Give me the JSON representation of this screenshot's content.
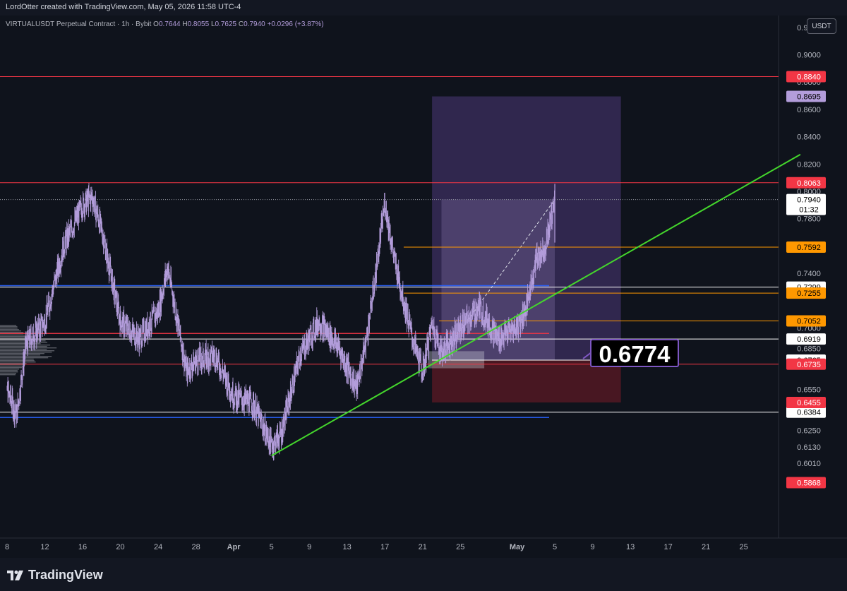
{
  "header": {
    "credit": "LordOtter created with TradingView.com, May 05, 2026 11:58 UTC-4"
  },
  "legend": {
    "symbol": "VIRTUALUSDT Perpetual Contract · 1h · Bybit",
    "open_label": "O",
    "open": "0.7644",
    "high_label": "H",
    "high": "0.8055",
    "low_label": "L",
    "low": "0.7625",
    "close_label": "C",
    "close": "0.7940",
    "change": "+0.0296 (+3.87%)"
  },
  "toolbar": {
    "currency": "USDT"
  },
  "callout": {
    "value": "0.6774"
  },
  "footer": {
    "brand": "TradingView"
  },
  "colors": {
    "background": "#0f131c",
    "candles": "#b39ddb",
    "red_level": "#f23645",
    "orange_level": "#ff9800",
    "blue_level": "#2962ff",
    "white_level": "#ffffff",
    "trendline": "#44d62c",
    "target_zone": "#7e57c2",
    "stop_zone": "#5c1a24"
  },
  "chart_data": {
    "type": "candlestick",
    "interval": "1h",
    "y_axis_ticks": [
      "0.9200",
      "0.9000",
      "0.8800",
      "0.8600",
      "0.8400",
      "0.8200",
      "0.8000",
      "0.7800",
      "0.7400",
      "0.7000",
      "0.6850",
      "0.6550",
      "0.6250",
      "0.6130",
      "0.6010"
    ],
    "x_axis_ticks": [
      "8",
      "12",
      "16",
      "20",
      "24",
      "28",
      "Apr",
      "5",
      "9",
      "13",
      "17",
      "21",
      "25",
      "May",
      "5",
      "9",
      "13",
      "17",
      "21",
      "25"
    ],
    "ylim": [
      0.585,
      0.925
    ],
    "price_path": [
      [
        "Mar 8",
        0.655
      ],
      [
        "Mar 9",
        0.636
      ],
      [
        "Mar 10",
        0.688
      ],
      [
        "Mar 12",
        0.705
      ],
      [
        "Mar 14",
        0.76
      ],
      [
        "Mar 16",
        0.79
      ],
      [
        "Mar 17",
        0.796
      ],
      [
        "Mar 18",
        0.772
      ],
      [
        "Mar 20",
        0.705
      ],
      [
        "Mar 22",
        0.692
      ],
      [
        "Mar 24",
        0.712
      ],
      [
        "Mar 25",
        0.745
      ],
      [
        "Mar 27",
        0.668
      ],
      [
        "Mar 28",
        0.676
      ],
      [
        "Mar 30",
        0.68
      ],
      [
        "Apr 1",
        0.65
      ],
      [
        "Apr 3",
        0.645
      ],
      [
        "Apr 5",
        0.614
      ],
      [
        "Apr 6",
        0.622
      ],
      [
        "Apr 8",
        0.68
      ],
      [
        "Apr 10",
        0.705
      ],
      [
        "Apr 12",
        0.687
      ],
      [
        "Apr 14",
        0.656
      ],
      [
        "Apr 15",
        0.69
      ],
      [
        "Apr 16",
        0.738
      ],
      [
        "Apr 17",
        0.792
      ],
      [
        "Apr 18",
        0.75
      ],
      [
        "Apr 20",
        0.69
      ],
      [
        "Apr 21",
        0.668
      ],
      [
        "Apr 22",
        0.703
      ],
      [
        "Apr 23",
        0.682
      ],
      [
        "Apr 25",
        0.7
      ],
      [
        "Apr 27",
        0.715
      ],
      [
        "Apr 29",
        0.692
      ],
      [
        "May 1",
        0.701
      ],
      [
        "May 2",
        0.715
      ],
      [
        "May 3",
        0.75
      ],
      [
        "May 4",
        0.76
      ],
      [
        "May 5",
        0.794
      ]
    ],
    "last_price": {
      "value": "0.7940",
      "countdown": "01:32"
    },
    "levels": [
      {
        "value": "0.8840",
        "color": "red"
      },
      {
        "value": "0.8063",
        "color": "red"
      },
      {
        "value": "0.7592",
        "color": "orange"
      },
      {
        "value": "0.7299",
        "color": "white"
      },
      {
        "value": "0.7255",
        "color": "orange"
      },
      {
        "value": "0.7052",
        "color": "orange"
      },
      {
        "value": "0.6919",
        "color": "white"
      },
      {
        "value": "0.6765",
        "color": "white"
      },
      {
        "value": "0.6735",
        "color": "red"
      },
      {
        "value": "0.6384",
        "color": "white"
      },
      {
        "value": "0.5868",
        "color": "red"
      }
    ],
    "unlabeled_levels": [
      {
        "value": 0.731,
        "color": "blue"
      },
      {
        "value": 0.696,
        "color": "red"
      },
      {
        "value": 0.6345,
        "color": "blue"
      }
    ],
    "position": {
      "type": "long",
      "entry": "0.6765",
      "target": "0.8695",
      "stop": "0.6455",
      "start": "Apr 22",
      "end": "May 12"
    },
    "trendline": {
      "from": [
        "Apr 5",
        0.6065
      ],
      "to": [
        "May 31",
        0.827
      ]
    },
    "annotation": "0.6774",
    "volume_profile": true,
    "grid": false
  }
}
